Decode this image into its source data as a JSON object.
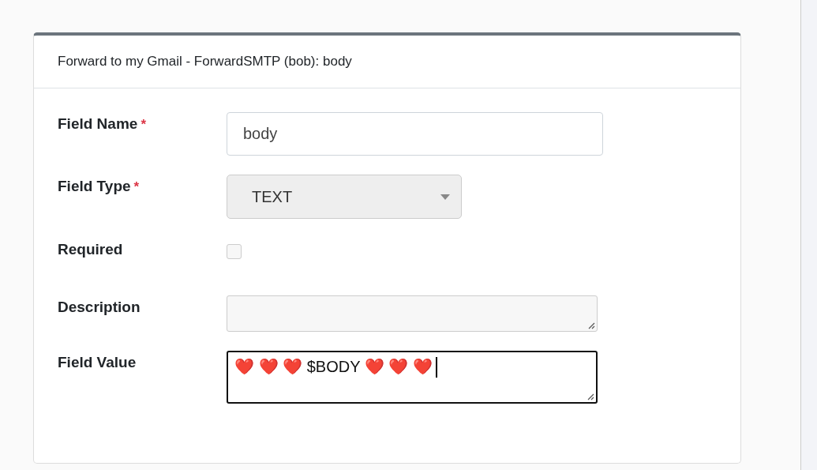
{
  "card": {
    "title": "Forward to my Gmail - ForwardSMTP (bob): body"
  },
  "fields": [
    {
      "kind": "text",
      "label": "Field Name",
      "marker": "*",
      "value": "body",
      "focused": false
    },
    {
      "kind": "select",
      "label": "Field Type",
      "marker": "*",
      "value": "TEXT",
      "focused": false
    },
    {
      "kind": "checkbox",
      "label": "Required",
      "checked": false
    },
    {
      "kind": "textarea",
      "label": "Description",
      "focused": false
    },
    {
      "kind": "textarea",
      "label": "Field Value",
      "value": "❤️ ❤️ ❤️ $BODY ❤️ ❤️ ❤️",
      "focused": true
    }
  ]
}
